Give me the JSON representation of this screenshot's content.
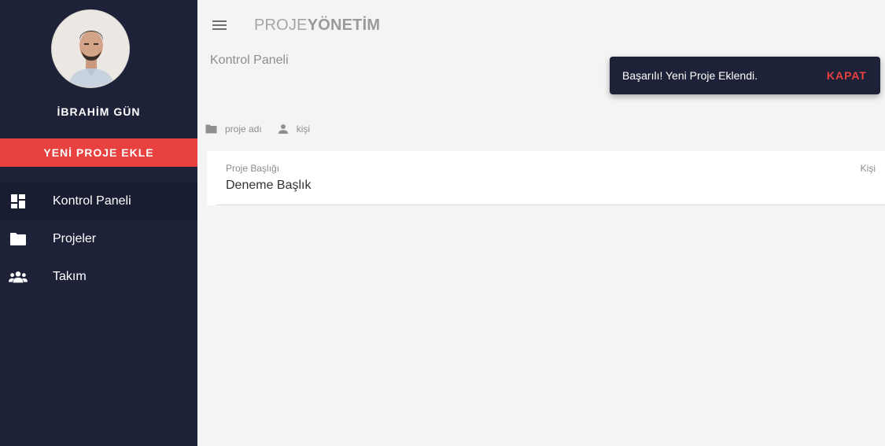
{
  "sidebar": {
    "user_name": "İBRAHİM GÜN",
    "new_project_label": "YENİ PROJE EKLE",
    "items": [
      {
        "label": "Kontrol Paneli",
        "icon": "dashboard-icon",
        "active": true
      },
      {
        "label": "Projeler",
        "icon": "folder-icon",
        "active": false
      },
      {
        "label": "Takım",
        "icon": "team-icon",
        "active": false
      }
    ]
  },
  "header": {
    "brand_light": "PROJE",
    "brand_strong": "YÖNETİM",
    "menu_icon": "hamburger-menu-icon"
  },
  "page": {
    "title": "Kontrol Paneli"
  },
  "filters": {
    "project_name_label": "proje adı",
    "person_label": "kişi"
  },
  "projects": {
    "columns": {
      "title": "Proje Başlığı",
      "person": "Kişi"
    },
    "rows": [
      {
        "title": "Deneme Başlık",
        "person": ""
      }
    ]
  },
  "snackbar": {
    "message": "Başarılı! Yeni Proje Eklendi.",
    "action": "KAPAT"
  },
  "colors": {
    "sidebar_bg": "#1e2238",
    "accent": "#e8413f",
    "main_bg": "#f4f4f4"
  }
}
